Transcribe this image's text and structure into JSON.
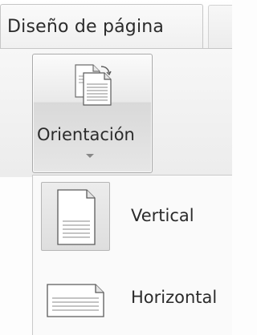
{
  "ribbon": {
    "active_tab": "Diseño de página"
  },
  "orientation_button": {
    "label": "Orientación",
    "icon": "page-orientation-icon"
  },
  "orientation_menu": {
    "items": [
      {
        "label": "Vertical",
        "icon": "portrait-page-icon",
        "selected": true
      },
      {
        "label": "Horizontal",
        "icon": "landscape-page-icon",
        "selected": false
      }
    ]
  }
}
